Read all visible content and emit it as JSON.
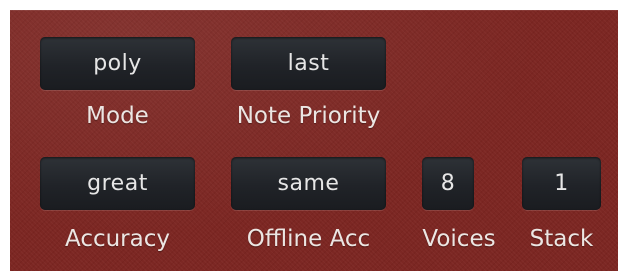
{
  "controls": {
    "mode": {
      "value": "poly",
      "label": "Mode"
    },
    "note_priority": {
      "value": "last",
      "label": "Note Priority"
    },
    "accuracy": {
      "value": "great",
      "label": "Accuracy"
    },
    "offline_acc": {
      "value": "same",
      "label": "Offline Acc"
    },
    "voices": {
      "value": "8",
      "label": "Voices"
    },
    "stack": {
      "value": "1",
      "label": "Stack"
    }
  },
  "colors": {
    "panel_red": "#7c2521",
    "display_box": "#202328",
    "text": "#ece6e3"
  }
}
